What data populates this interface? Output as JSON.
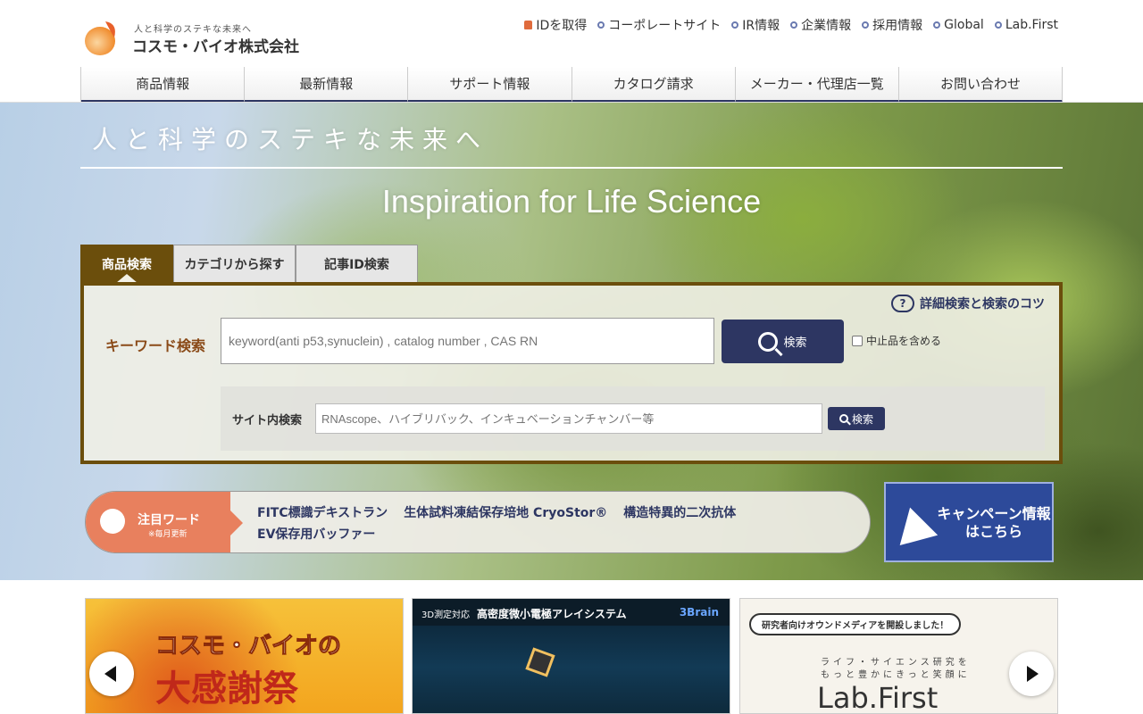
{
  "logo": {
    "tagline": "人と科学のステキな未来へ",
    "name": "コスモ・バイオ株式会社"
  },
  "toplinks": [
    {
      "label": "IDを取得",
      "icon": "lock-icon"
    },
    {
      "label": "コーポレートサイト",
      "icon": "circle-bullet-icon"
    },
    {
      "label": "IR情報",
      "icon": "circle-bullet-icon"
    },
    {
      "label": "企業情報",
      "icon": "circle-bullet-icon"
    },
    {
      "label": "採用情報",
      "icon": "circle-bullet-icon"
    },
    {
      "label": "Global",
      "icon": "circle-bullet-icon"
    },
    {
      "label": "Lab.First",
      "icon": "circle-bullet-icon"
    }
  ],
  "gnav": [
    "商品情報",
    "最新情報",
    "サポート情報",
    "カタログ請求",
    "メーカー・代理店一覧",
    "お問い合わせ"
  ],
  "hero": {
    "jp": "人と科学のステキな未来へ",
    "en": "Inspiration for Life Science"
  },
  "search": {
    "tabs": [
      "商品検索",
      "カテゴリから探す",
      "記事ID検索"
    ],
    "tips": "詳細検索と検索のコツ",
    "keyword_label": "キーワード検索",
    "keyword_placeholder": "keyword(anti p53,synuclein) , catalog number , CAS RN",
    "keyword_button": "検索",
    "discontinued_label": "中止品を含める",
    "site_label": "サイト内検索",
    "site_placeholder": "RNAscope、ハイブリバック、インキュベーションチャンバー等",
    "site_button": "検索"
  },
  "attention": {
    "title": "注目ワード",
    "subtitle": "※毎月更新",
    "words": [
      "FITC標識デキストラン",
      "生体試料凍結保存培地 CryoStor®",
      "構造特異的二次抗体",
      "EV保存用バッファー"
    ]
  },
  "campaign": {
    "label": "キャンペーン情報はこちら"
  },
  "banners": {
    "b1_title1": "コスモ・バイオの",
    "b1_title2": "大感謝祭",
    "b2_prefix": "3D測定対応",
    "b2_title": "高密度微小電極アレイシステム",
    "b2_brand": "3Brain",
    "b3_bubble": "研究者向けオウンドメディアを開設しました！",
    "b3_line1": "ライフ・サイエンス研究を",
    "b3_line2": "もっと豊かにきっと笑顔に",
    "b3_logo": "Lab.First"
  },
  "colors": {
    "navy": "#2d3662",
    "brown": "#6b4e0c",
    "coral": "#e8805e",
    "campaign_blue": "#2d4a9a"
  }
}
